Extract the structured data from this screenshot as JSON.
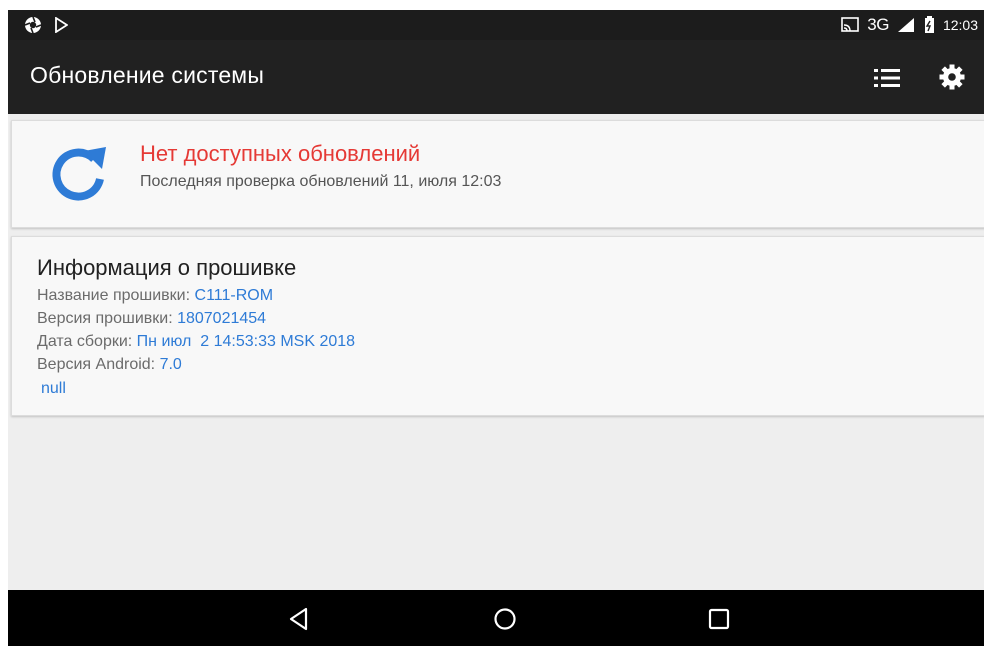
{
  "status_bar": {
    "network_label": "3G",
    "network_superscript": "3G",
    "time": "12:03"
  },
  "toolbar": {
    "title": "Обновление системы"
  },
  "update_card": {
    "title": "Нет доступных обновлений",
    "subtitle": "Последняя проверка обновлений 11, июля 12:03"
  },
  "firmware_info": {
    "title": "Информация о прошивке",
    "rows": [
      {
        "label": "Название прошивки: ",
        "value": "C111-ROM"
      },
      {
        "label": "Версия прошивки: ",
        "value": "1807021454"
      },
      {
        "label": "Дата сборки: ",
        "value": "Пн июл  2 14:53:33 MSK 2018"
      },
      {
        "label": "Версия Android: ",
        "value": "7.0"
      }
    ],
    "extra": "null"
  },
  "colors": {
    "accent_blue": "#2e7bd6",
    "alert_red": "#e53935",
    "toolbar_bg": "#212121"
  }
}
